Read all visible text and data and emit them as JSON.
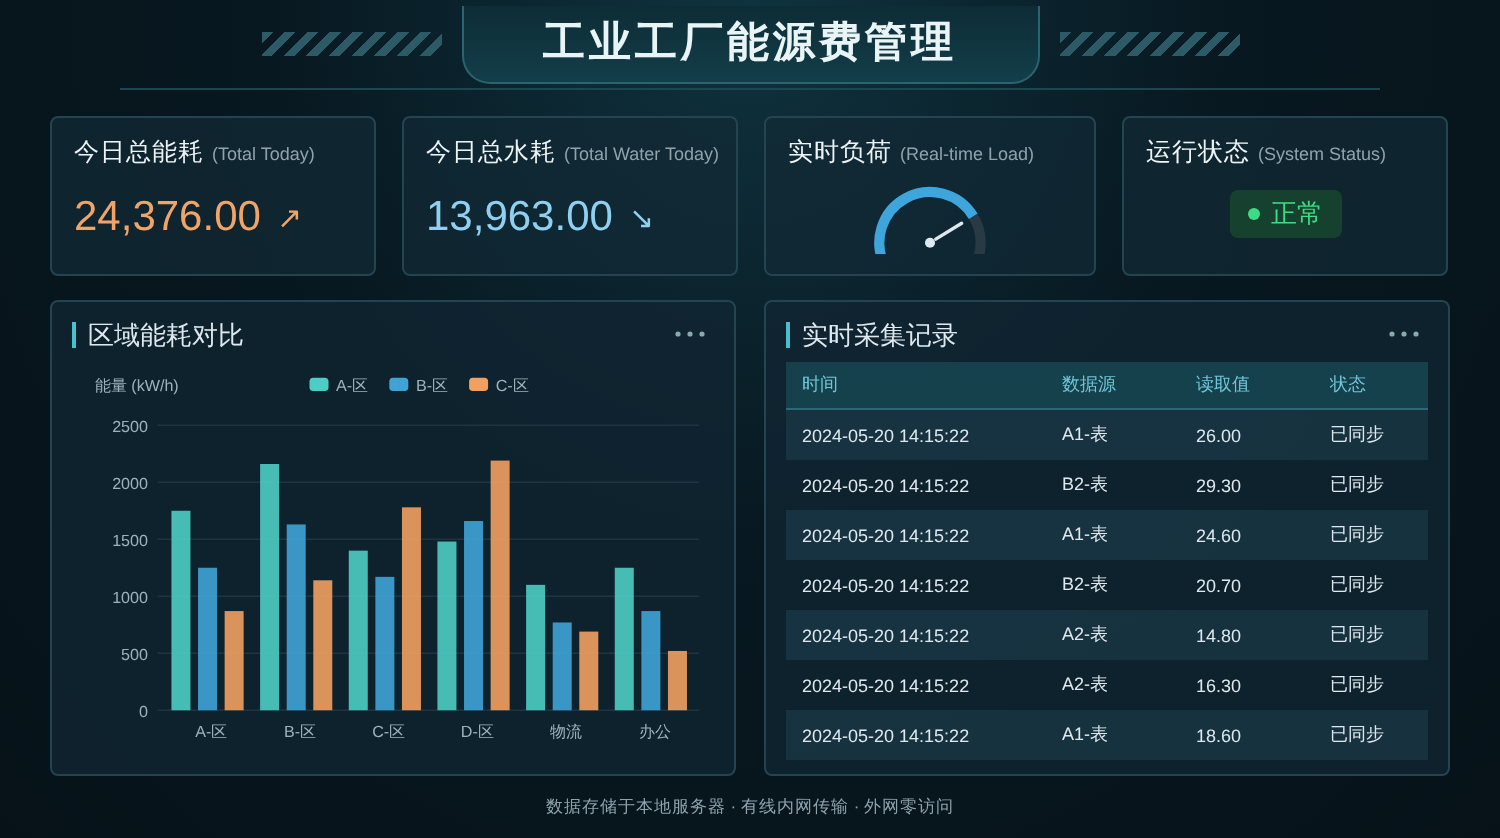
{
  "title": "工业工厂能源费管理",
  "cards": [
    {
      "kind": "value",
      "label": "今日总能耗",
      "sublabel": "(Total Today)",
      "value": "24,376.00",
      "trend": "↗",
      "color": "#f0a468"
    },
    {
      "kind": "value",
      "label": "今日总水耗",
      "sublabel": "(Total Water Today)",
      "value": "13,963.00",
      "trend": "↘",
      "color": "#8fd0f0"
    },
    {
      "kind": "gauge",
      "label": "实时负荷",
      "sublabel": "(Real-time Load)"
    },
    {
      "kind": "status",
      "label": "运行状态",
      "sublabel": "(System Status)",
      "status": "正常",
      "color": "#3ddc84"
    }
  ],
  "chart_panel": {
    "title": "区域能耗对比",
    "chart_data": {
      "type": "bar",
      "legend": "top",
      "grid": true,
      "ylabel": "能量 (kW/h)",
      "categories": [
        "A-区",
        "B-区",
        "C-区",
        "D-区",
        "物流",
        "办公"
      ],
      "ylim": [
        0,
        2500
      ],
      "yticks": [
        0,
        500,
        1000,
        1500,
        2000,
        2500
      ],
      "series": [
        {
          "name": "A-区",
          "color": "#4ecdc4",
          "values": [
            1750,
            2160,
            1400,
            1480,
            1100,
            1250
          ]
        },
        {
          "name": "B-区",
          "color": "#3fa3d6",
          "values": [
            1250,
            1630,
            1170,
            1660,
            770,
            870
          ]
        },
        {
          "name": "C-区",
          "color": "#f0a060",
          "values": [
            870,
            1140,
            1780,
            2190,
            690,
            520
          ]
        }
      ]
    }
  },
  "table_panel": {
    "title": "实时采集记录",
    "columns": [
      "时间",
      "数据源",
      "读取值",
      "状态"
    ],
    "rows": [
      [
        "2024-05-20 14:15:22",
        "A1-表",
        "26.00",
        "已同步"
      ],
      [
        "2024-05-20 14:15:22",
        "B2-表",
        "29.30",
        "已同步"
      ],
      [
        "2024-05-20 14:15:22",
        "A1-表",
        "24.60",
        "已同步"
      ],
      [
        "2024-05-20 14:15:22",
        "B2-表",
        "20.70",
        "已同步"
      ],
      [
        "2024-05-20 14:15:22",
        "A2-表",
        "14.80",
        "已同步"
      ],
      [
        "2024-05-20 14:15:22",
        "A2-表",
        "16.30",
        "已同步"
      ],
      [
        "2024-05-20 14:15:22",
        "A1-表",
        "18.60",
        "已同步"
      ]
    ]
  },
  "footer": "数据存储于本地服务器 · 有线内网传输 · 外网零访问"
}
